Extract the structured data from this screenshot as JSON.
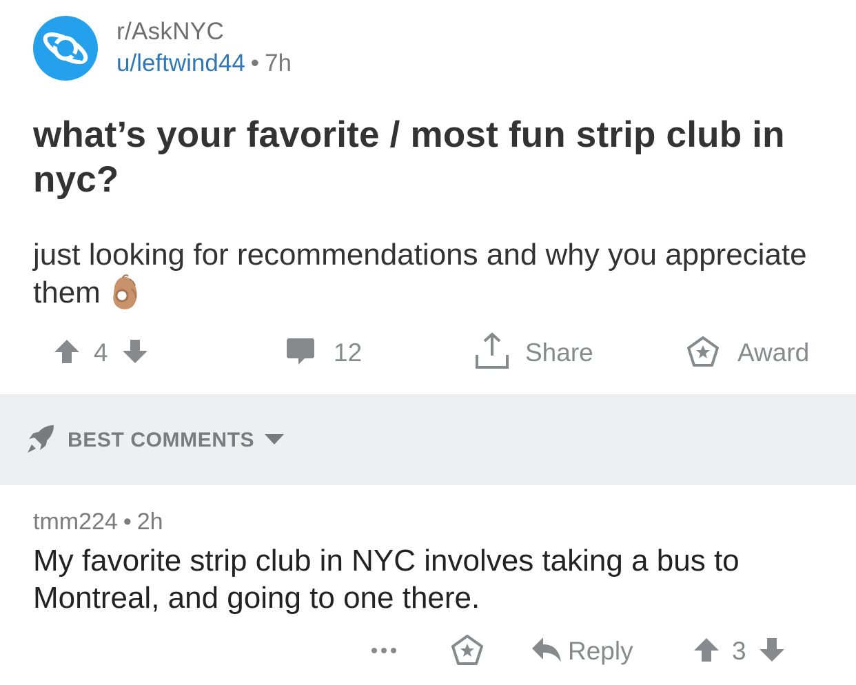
{
  "post": {
    "subreddit": "r/AskNYC",
    "author": "u/leftwind44",
    "separator": "•",
    "age": "7h",
    "title": "what’s your favorite / most fun strip club in nyc?",
    "body": "just looking for recommendations and why you appreciate them",
    "emoji": "ok-hand",
    "score": "4",
    "comment_count": "12",
    "share_label": "Share",
    "award_label": "Award"
  },
  "comments_section": {
    "sort_label": "BEST COMMENTS"
  },
  "comment": {
    "author": "tmm224",
    "separator": "•",
    "age": "2h",
    "text": "My favorite strip club in NYC involves taking a bus to Montreal, and going to one there.",
    "reply_label": "Reply",
    "score": "3"
  },
  "colors": {
    "accent_blue": "#24a0ed",
    "username_blue": "#2f78b7",
    "icon_gray": "#878a8c",
    "section_bg": "#edeff1"
  }
}
